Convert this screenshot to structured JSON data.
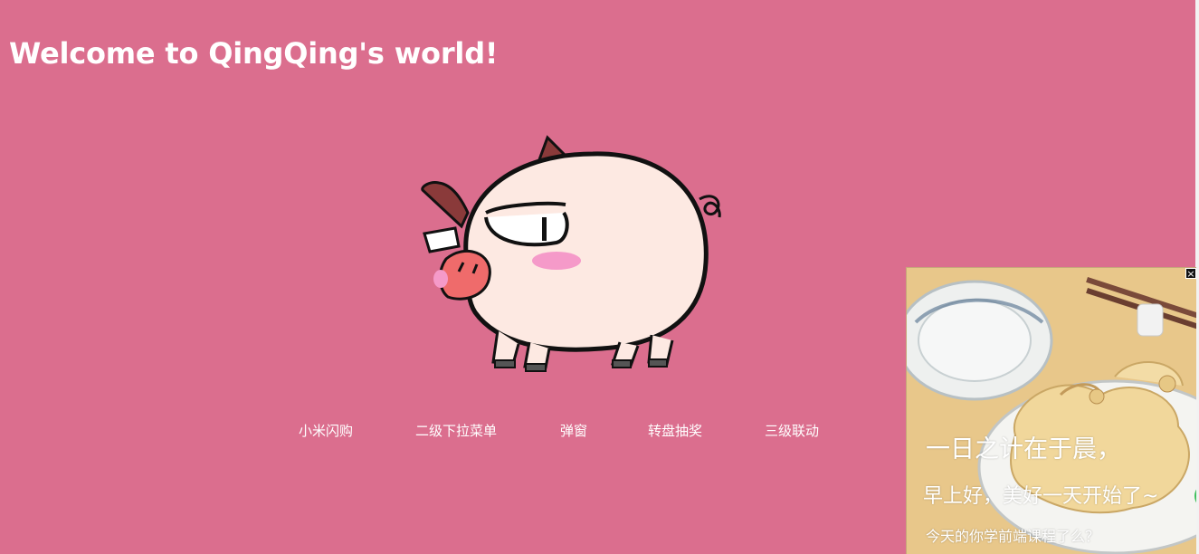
{
  "header": {
    "title": "Welcome to QingQing's world!"
  },
  "nav": {
    "items": [
      {
        "label": "小米闪购"
      },
      {
        "label": "二级下拉菜单"
      },
      {
        "label": "弹窗"
      },
      {
        "label": "转盘抽奖"
      },
      {
        "label": "三级联动"
      }
    ]
  },
  "popup_ad": {
    "close_label": "×",
    "line1": "一日之计在于晨，",
    "line2": "早上好，美好一天开始了~",
    "line3": "今天的你学前端课程了么？"
  },
  "colors": {
    "background": "#db6e8e",
    "text": "#ffffff"
  }
}
